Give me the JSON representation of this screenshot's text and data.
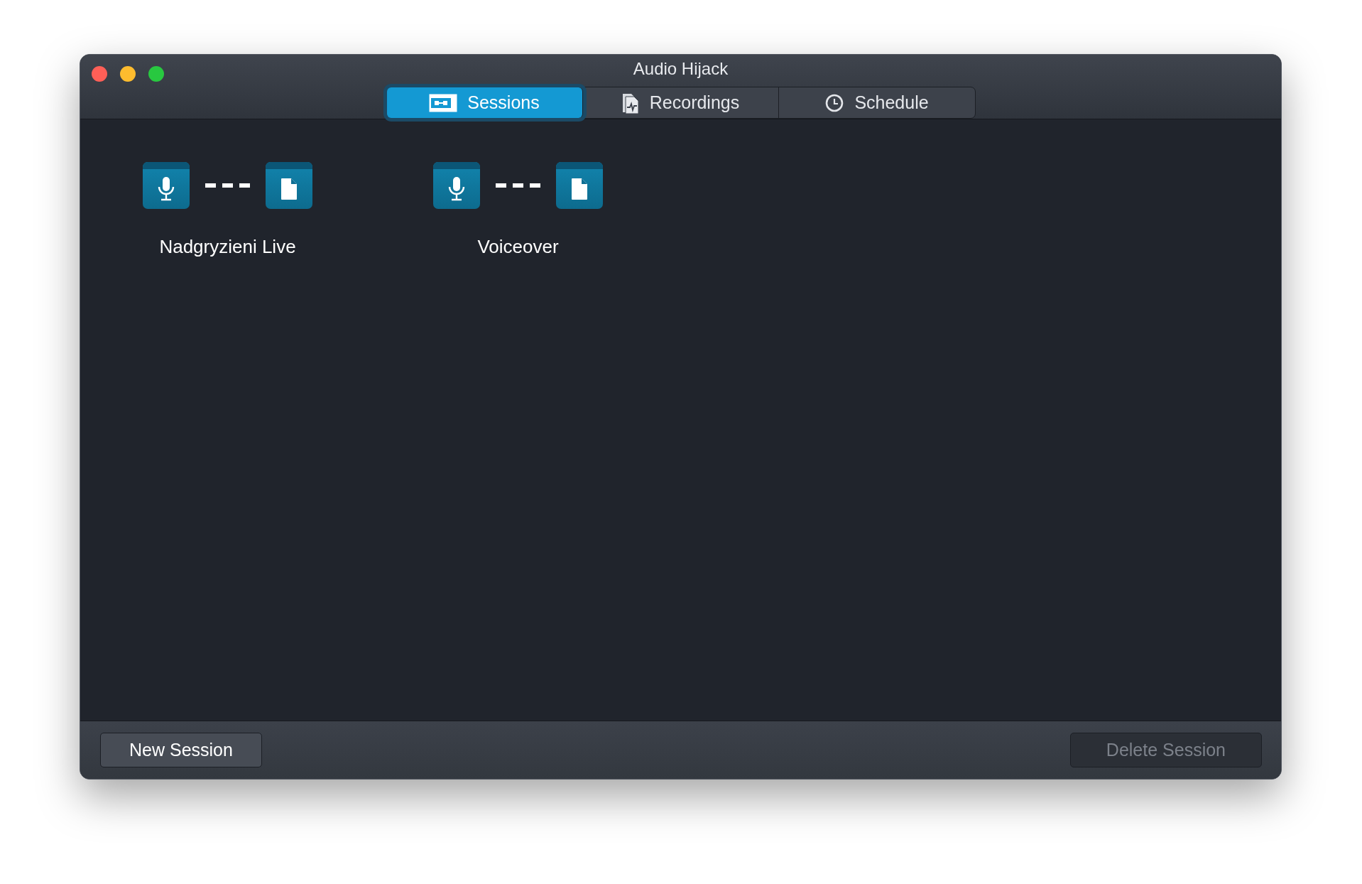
{
  "window": {
    "title": "Audio Hijack"
  },
  "tabs": [
    {
      "label": "Sessions",
      "kind": "sessions",
      "selected": true
    },
    {
      "label": "Recordings",
      "kind": "recordings",
      "selected": false
    },
    {
      "label": "Schedule",
      "kind": "schedule",
      "selected": false
    }
  ],
  "sessions": [
    {
      "name": "Nadgryzieni Live"
    },
    {
      "name": "Voiceover"
    }
  ],
  "footer": {
    "buttons": [
      {
        "label": "New Session",
        "disabled": false
      },
      {
        "label": "Delete Session",
        "disabled": true
      }
    ]
  }
}
